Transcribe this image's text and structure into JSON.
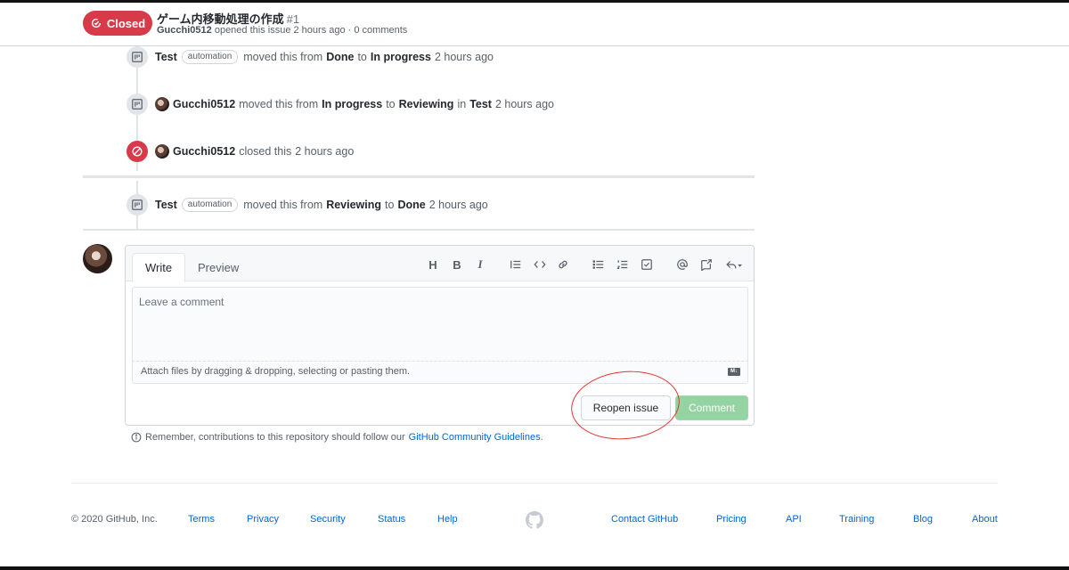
{
  "header": {
    "state_label": "Closed",
    "title": "ゲーム内移動処理の作成",
    "number": "#1",
    "author": "Gucchi0512",
    "meta_rest": "opened this issue 2 hours ago · 0 comments"
  },
  "timeline": [
    {
      "actor": "Test",
      "tag": "automation",
      "text1": "moved this from",
      "from": "Done",
      "text2": "to",
      "to": "In progress",
      "time": "2 hours ago"
    },
    {
      "actor": "Gucchi0512",
      "text1": "moved this from",
      "from": "In progress",
      "text2": "to",
      "to": "Reviewing",
      "text3": "in",
      "project": "Test",
      "time": "2 hours ago"
    },
    {
      "actor": "Gucchi0512",
      "text1": "closed this",
      "time": "2 hours ago"
    },
    {
      "actor": "Test",
      "tag": "automation",
      "text1": "moved this from",
      "from": "Reviewing",
      "text2": "to",
      "to": "Done",
      "time": "2 hours ago"
    }
  ],
  "comment": {
    "tab_write": "Write",
    "tab_preview": "Preview",
    "toolbar_heading": "H",
    "toolbar_bold": "B",
    "toolbar_italic": "I",
    "placeholder": "Leave a comment",
    "attach_hint": "Attach files by dragging & dropping, selecting or pasting them.",
    "reopen_label": "Reopen issue",
    "comment_label": "Comment"
  },
  "guidelines": {
    "prefix": "Remember, contributions to this repository should follow our",
    "link": "GitHub Community Guidelines",
    "suffix": "."
  },
  "footer": {
    "copyright": "© 2020 GitHub, Inc.",
    "links_left": [
      "Terms",
      "Privacy",
      "Security",
      "Status",
      "Help"
    ],
    "links_right": [
      "Contact GitHub",
      "Pricing",
      "API",
      "Training",
      "Blog",
      "About"
    ]
  },
  "colors": {
    "closed": "#d73a49",
    "link": "#0366d6",
    "comment_button": "#94d3a2",
    "annotation": "#e3342f"
  }
}
